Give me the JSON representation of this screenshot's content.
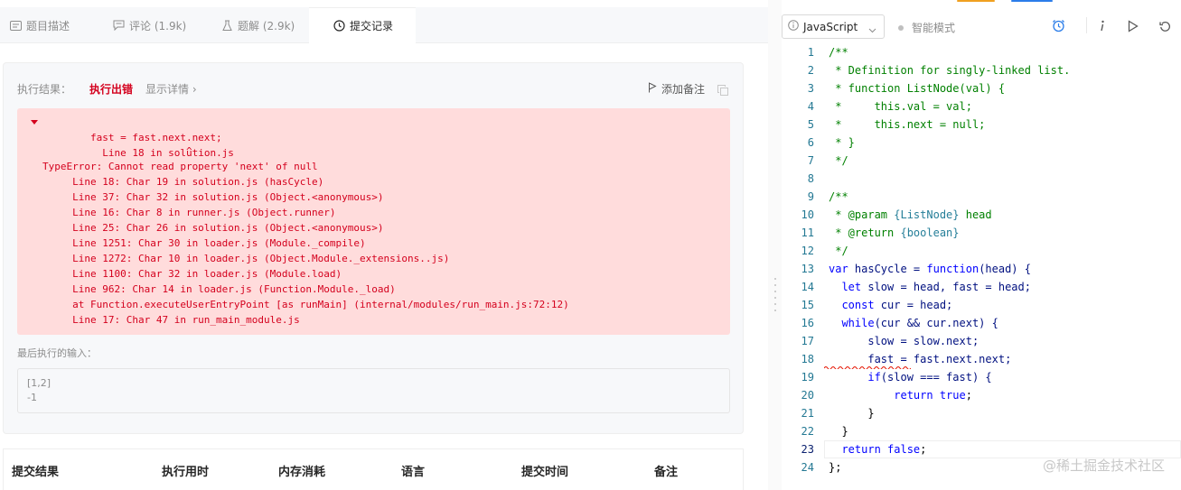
{
  "tabs": [
    {
      "label": "题目描述",
      "icon": "description-icon"
    },
    {
      "label": "评论 (1.9k)",
      "icon": "comment-icon"
    },
    {
      "label": "题解 (2.9k)",
      "icon": "flask-icon"
    },
    {
      "label": "提交记录",
      "icon": "clock-icon"
    }
  ],
  "result": {
    "label": "执行结果：",
    "status": "执行出错",
    "detail": "显示详情 ›",
    "add_note": "添加备注"
  },
  "error_lines": [
    "Line 18 in solution.js",
    "        fast = fast.next.next;",
    "                        ^",
    "TypeError: Cannot read property 'next' of null",
    "     Line 18: Char 19 in solution.js (hasCycle)",
    "     Line 37: Char 32 in solution.js (Object.<anonymous>)",
    "     Line 16: Char 8 in runner.js (Object.runner)",
    "     Line 25: Char 26 in solution.js (Object.<anonymous>)",
    "     Line 1251: Char 30 in loader.js (Module._compile)",
    "     Line 1272: Char 10 in loader.js (Object.Module._extensions..js)",
    "     Line 1100: Char 32 in loader.js (Module.load)",
    "     Line 962: Char 14 in loader.js (Function.Module._load)",
    "     at Function.executeUserEntryPoint [as runMain] (internal/modules/run_main.js:72:12)",
    "     Line 17: Char 47 in run_main_module.js"
  ],
  "last_input": {
    "label": "最后执行的输入：",
    "lines": [
      "[1,2]",
      "-1"
    ]
  },
  "submissions_headers": [
    "提交结果",
    "执行用时",
    "内存消耗",
    "语言",
    "提交时间",
    "备注"
  ],
  "editor": {
    "language": "JavaScript",
    "smart_mode": "智能模式",
    "line_numbers": [
      "1",
      "2",
      "3",
      "4",
      "5",
      "6",
      "7",
      "8",
      "9",
      "10",
      "11",
      "12",
      "13",
      "14",
      "15",
      "16",
      "17",
      "18",
      "19",
      "20",
      "21",
      "22",
      "23",
      "24"
    ],
    "current_line": "23"
  },
  "watermark": "@稀土掘金技术社区",
  "colors": {
    "error_bg": "#ffdcdc",
    "error_text": "#d4001d",
    "comment": "#008000",
    "keyword": "#0000ff"
  }
}
